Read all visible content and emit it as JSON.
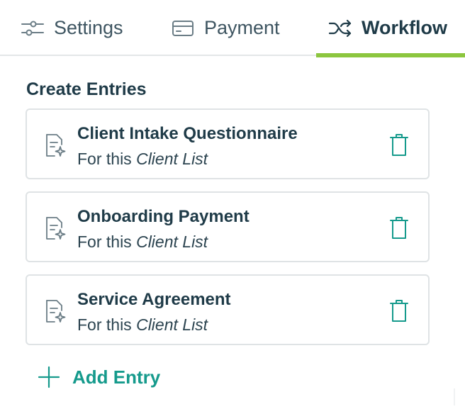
{
  "tabs": [
    {
      "label": "Settings",
      "icon": "sliders-icon",
      "active": false
    },
    {
      "label": "Payment",
      "icon": "credit-card-icon",
      "active": false
    },
    {
      "label": "Workflow",
      "icon": "shuffle-icon",
      "active": true
    }
  ],
  "section": {
    "title": "Create Entries"
  },
  "entries": [
    {
      "title": "Client Intake Questionnaire",
      "sub_prefix": "For this",
      "sub_target": "Client List"
    },
    {
      "title": "Onboarding Payment",
      "sub_prefix": "For this",
      "sub_target": "Client List"
    },
    {
      "title": "Service Agreement",
      "sub_prefix": "For this",
      "sub_target": "Client List"
    }
  ],
  "add_entry": {
    "label": "Add Entry"
  },
  "colors": {
    "accent_green": "#8cc63f",
    "teal": "#159a8c",
    "text_dark": "#1f3b48",
    "border": "#dfe3e5"
  }
}
